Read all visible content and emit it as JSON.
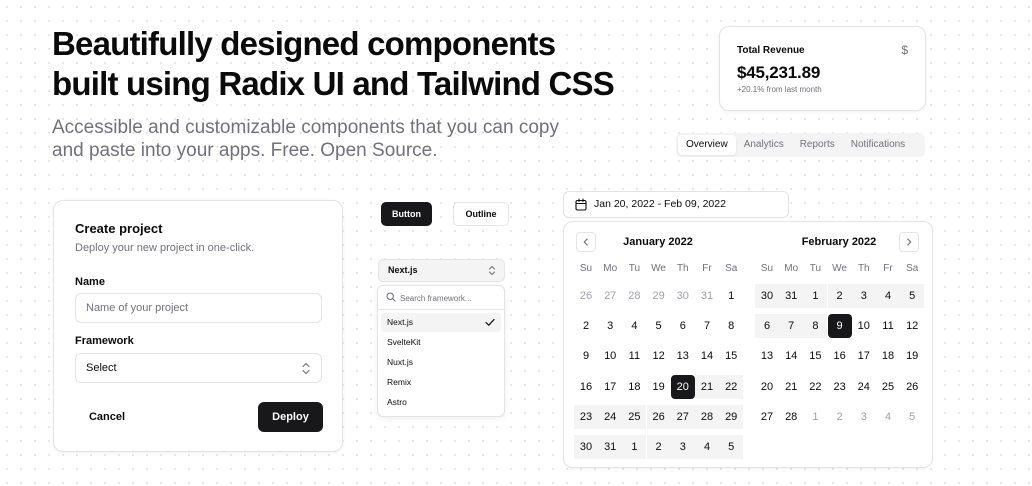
{
  "hero": {
    "title_line1": "Beautifully designed components",
    "title_line2": "built using Radix UI and Tailwind CSS",
    "subtitle_line1": "Accessible and customizable components that you can copy",
    "subtitle_line2": "and paste into your apps. Free. Open Source."
  },
  "revenue": {
    "label": "Total Revenue",
    "icon": "dollar-icon",
    "currency_symbol": "$",
    "value": "$45,231.89",
    "change": "+20.1% from last month"
  },
  "tabs": [
    {
      "label": "Overview",
      "active": true
    },
    {
      "label": "Analytics",
      "active": false
    },
    {
      "label": "Reports",
      "active": false
    },
    {
      "label": "Notifications",
      "active": false
    }
  ],
  "create_project": {
    "title": "Create project",
    "description": "Deploy your new project in one-click.",
    "name_label": "Name",
    "name_placeholder": "Name of your project",
    "framework_label": "Framework",
    "framework_value": "Select",
    "cancel_label": "Cancel",
    "deploy_label": "Deploy"
  },
  "buttons": {
    "primary_label": "Button",
    "outline_label": "Outline"
  },
  "combobox": {
    "selected": "Next.js",
    "search_placeholder": "Search framework...",
    "items": [
      "Next.js",
      "SvelteKit",
      "Nuxt.js",
      "Remix",
      "Astro"
    ],
    "checked_index": 0
  },
  "date_range": {
    "label": "Jan 20, 2022 - Feb 09, 2022"
  },
  "calendar": {
    "weekdays": [
      "Su",
      "Mo",
      "Tu",
      "We",
      "Th",
      "Fr",
      "Sa"
    ],
    "months": [
      {
        "title": "January 2022",
        "days": [
          [
            {
              "d": "26",
              "out": true
            },
            {
              "d": "27",
              "out": true
            },
            {
              "d": "28",
              "out": true
            },
            {
              "d": "29",
              "out": true
            },
            {
              "d": "30",
              "out": true
            },
            {
              "d": "31",
              "out": true
            },
            {
              "d": "1"
            }
          ],
          [
            {
              "d": "2"
            },
            {
              "d": "3"
            },
            {
              "d": "4"
            },
            {
              "d": "5"
            },
            {
              "d": "6"
            },
            {
              "d": "7"
            },
            {
              "d": "8"
            }
          ],
          [
            {
              "d": "9"
            },
            {
              "d": "10"
            },
            {
              "d": "11"
            },
            {
              "d": "12"
            },
            {
              "d": "13"
            },
            {
              "d": "14"
            },
            {
              "d": "15"
            }
          ],
          [
            {
              "d": "16"
            },
            {
              "d": "17"
            },
            {
              "d": "18"
            },
            {
              "d": "19"
            },
            {
              "d": "20",
              "sel": true
            },
            {
              "d": "21",
              "range": true
            },
            {
              "d": "22",
              "range": true
            }
          ],
          [
            {
              "d": "23",
              "range": true
            },
            {
              "d": "24",
              "range": true
            },
            {
              "d": "25",
              "range": true
            },
            {
              "d": "26",
              "range": true
            },
            {
              "d": "27",
              "range": true
            },
            {
              "d": "28",
              "range": true
            },
            {
              "d": "29",
              "range": true
            }
          ],
          [
            {
              "d": "30",
              "range": true
            },
            {
              "d": "31",
              "range": true
            },
            {
              "d": "1",
              "range": true
            },
            {
              "d": "2",
              "range": true
            },
            {
              "d": "3",
              "range": true
            },
            {
              "d": "4",
              "range": true
            },
            {
              "d": "5",
              "range": true
            }
          ]
        ]
      },
      {
        "title": "February 2022",
        "days": [
          [
            {
              "d": "30",
              "range": true
            },
            {
              "d": "31",
              "range": true
            },
            {
              "d": "1",
              "range": true
            },
            {
              "d": "2",
              "range": true
            },
            {
              "d": "3",
              "range": true
            },
            {
              "d": "4",
              "range": true
            },
            {
              "d": "5",
              "range": true
            }
          ],
          [
            {
              "d": "6",
              "range": true
            },
            {
              "d": "7",
              "range": true
            },
            {
              "d": "8",
              "range": true
            },
            {
              "d": "9",
              "sel": true
            },
            {
              "d": "10"
            },
            {
              "d": "11"
            },
            {
              "d": "12"
            }
          ],
          [
            {
              "d": "13"
            },
            {
              "d": "14"
            },
            {
              "d": "15"
            },
            {
              "d": "16"
            },
            {
              "d": "17"
            },
            {
              "d": "18"
            },
            {
              "d": "19"
            }
          ],
          [
            {
              "d": "20"
            },
            {
              "d": "21"
            },
            {
              "d": "22"
            },
            {
              "d": "23"
            },
            {
              "d": "24"
            },
            {
              "d": "25"
            },
            {
              "d": "26"
            }
          ],
          [
            {
              "d": "27"
            },
            {
              "d": "28"
            },
            {
              "d": "1",
              "out": true
            },
            {
              "d": "2",
              "out": true
            },
            {
              "d": "3",
              "out": true
            },
            {
              "d": "4",
              "out": true
            },
            {
              "d": "5",
              "out": true
            }
          ]
        ]
      }
    ]
  },
  "colors": {
    "primary": "#18181b",
    "muted": "#f4f4f5",
    "muted_text": "#71717a",
    "border": "#e4e4e7"
  }
}
